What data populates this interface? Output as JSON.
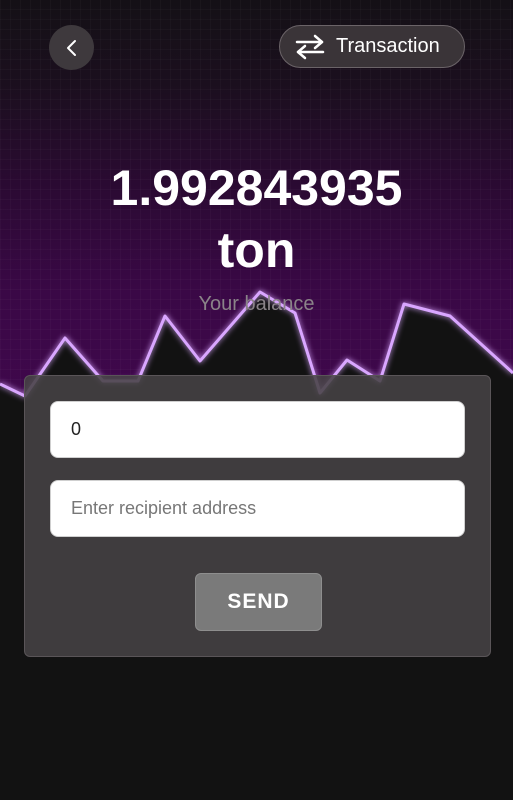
{
  "header": {
    "back_icon": "chevron-left-icon",
    "transaction_icon": "arrows-swap-icon",
    "transaction_label": "Transaction"
  },
  "balance": {
    "amount": "1.992843935",
    "unit": "ton",
    "caption": "Your balance"
  },
  "form": {
    "amount_value": "0",
    "address_value": "",
    "address_placeholder": "Enter recipient address",
    "send_label": "SEND"
  },
  "colors": {
    "background": "#121212",
    "accent_purple": "#40074d",
    "chart_line": "#d9a6ff",
    "card": "#464244",
    "send_button": "#7a7a7a"
  }
}
